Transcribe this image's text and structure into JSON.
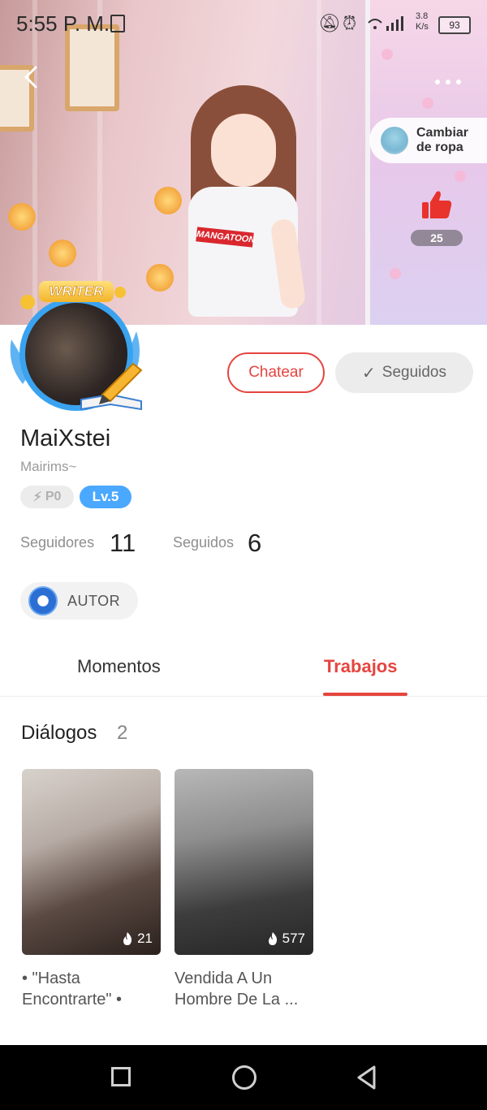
{
  "status_bar": {
    "time": "5:55 P. M.",
    "network_speed": "3.8 K/s",
    "battery": "93"
  },
  "header": {
    "change_outfit_line1": "Cambiar",
    "change_outfit_line2": "de ropa",
    "like_count": "25",
    "shirt_logo": "MANGATOON",
    "writer_badge": "WRITER"
  },
  "actions": {
    "chat_label": "Chatear",
    "following_label": "Seguidos"
  },
  "profile": {
    "name": "MaiXstei",
    "subname": "Mairims~",
    "points_badge": "P0",
    "level_badge": "Lv.5",
    "followers_label": "Seguidores",
    "followers_count": "11",
    "following_label": "Seguidos",
    "following_count": "6",
    "role_label": "AUTOR"
  },
  "tabs": [
    {
      "label": "Momentos",
      "active": false
    },
    {
      "label": "Trabajos",
      "active": true
    }
  ],
  "section": {
    "title": "Diálogos",
    "count": "2"
  },
  "works": [
    {
      "title_line1": "• \"Hasta",
      "title_line2": "Encontrarte\" •",
      "views": "21"
    },
    {
      "title_line1": "Vendida A Un",
      "title_line2": "Hombre De La ...",
      "views": "577"
    }
  ],
  "colors": {
    "accent": "#e6443f",
    "level_blue": "#4aa8ff",
    "avatar_ring": "#3aa3f0"
  }
}
